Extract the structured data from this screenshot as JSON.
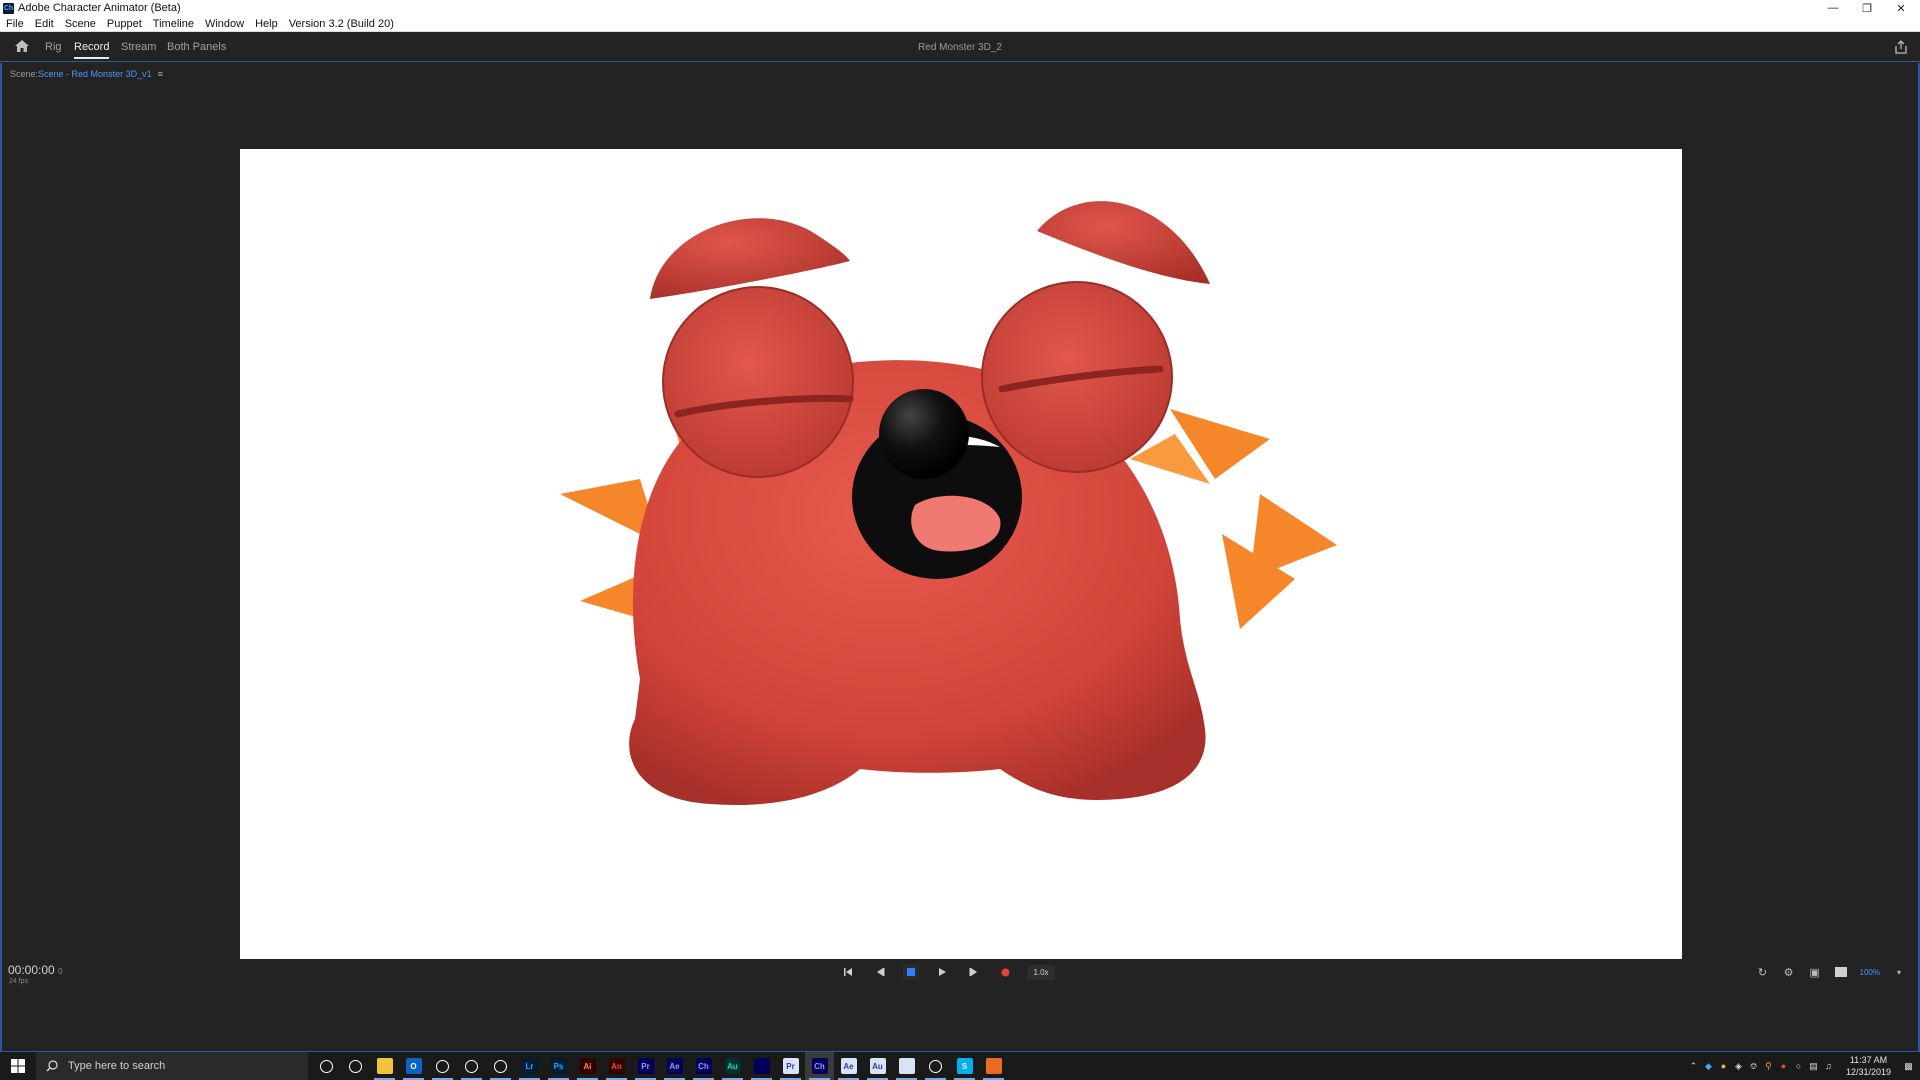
{
  "window": {
    "title": "Adobe Character Animator (Beta)",
    "app_icon": "Ch",
    "controls": [
      "minimize-icon",
      "restore-icon",
      "close-icon"
    ]
  },
  "menu": {
    "items": [
      "File",
      "Edit",
      "Scene",
      "Puppet",
      "Timeline",
      "Window",
      "Help",
      "Version 3.2 (Build 20)"
    ]
  },
  "workspace": {
    "tabs": [
      {
        "label": "Rig",
        "active": false
      },
      {
        "label": "Record",
        "active": true
      },
      {
        "label": "Stream",
        "active": false
      },
      {
        "label": "Both Panels",
        "active": false
      }
    ],
    "project_name": "Red Monster 3D_2"
  },
  "scene_panel": {
    "prefix": "Scene:",
    "scene_name": "Scene - Red Monster 3D_v1",
    "menu_glyph": "≡"
  },
  "footer": {
    "timecode": "00:00:00",
    "frame": "0",
    "fps": "24 fps",
    "speed": "1.0x",
    "zoom": "100%"
  },
  "colors": {
    "accent": "#2c58a0",
    "link": "#4f95ff",
    "record": "#e8413c",
    "monster_body": "#d94a3f",
    "spikes": "#f5862a",
    "background": "#232323"
  },
  "taskbar": {
    "search_placeholder": "Type here to search",
    "apps": [
      {
        "name": "cortana-icon",
        "label": "",
        "bg": "transparent",
        "fg": "#fff"
      },
      {
        "name": "task-view-icon",
        "label": "",
        "bg": "transparent",
        "fg": "#fff"
      },
      {
        "name": "file-explorer-icon",
        "label": "",
        "bg": "#f3c33b",
        "fg": "#000"
      },
      {
        "name": "outlook-icon",
        "label": "O",
        "bg": "#0a64c8",
        "fg": "#fff"
      },
      {
        "name": "chrome-icon",
        "label": "",
        "bg": "transparent",
        "fg": "#fff"
      },
      {
        "name": "chrome-badge-icon",
        "label": "",
        "bg": "transparent",
        "fg": "#fff"
      },
      {
        "name": "cinema4d-icon",
        "label": "",
        "bg": "transparent",
        "fg": "#fff"
      },
      {
        "name": "lightroom-icon",
        "label": "Lr",
        "bg": "#001d34",
        "fg": "#31a8ff"
      },
      {
        "name": "photoshop-icon",
        "label": "Ps",
        "bg": "#001d34",
        "fg": "#31a8ff"
      },
      {
        "name": "illustrator-icon",
        "label": "Ai",
        "bg": "#330000",
        "fg": "#ff9a00"
      },
      {
        "name": "animate-icon",
        "label": "An",
        "bg": "#330000",
        "fg": "#ff4a21"
      },
      {
        "name": "premiere-icon",
        "label": "Pr",
        "bg": "#00005b",
        "fg": "#9999ff"
      },
      {
        "name": "after-effects-icon",
        "label": "Ae",
        "bg": "#00005b",
        "fg": "#9999ff"
      },
      {
        "name": "character-animator-icon",
        "label": "Ch",
        "bg": "#00005b",
        "fg": "#9999ff"
      },
      {
        "name": "audition-icon",
        "label": "Au",
        "bg": "#00322b",
        "fg": "#00e4bb"
      },
      {
        "name": "media-encoder-icon",
        "label": "",
        "bg": "#00005b",
        "fg": "#9999ff"
      },
      {
        "name": "premiere-doc-icon",
        "label": "Pr",
        "bg": "#d7e4f5",
        "fg": "#2a3d8f"
      },
      {
        "name": "character-animator-active-icon",
        "label": "Ch",
        "bg": "#00005b",
        "fg": "#9999ff"
      },
      {
        "name": "after-effects-doc-icon",
        "label": "Ae",
        "bg": "#d7e4f5",
        "fg": "#2a3d8f"
      },
      {
        "name": "audition-doc-icon",
        "label": "Au",
        "bg": "#d7e4f5",
        "fg": "#2a3d8f"
      },
      {
        "name": "media-doc-icon",
        "label": "",
        "bg": "#d7e4f5",
        "fg": "#2a3d8f"
      },
      {
        "name": "cinema4d-2-icon",
        "label": "",
        "bg": "transparent",
        "fg": "#fff"
      },
      {
        "name": "skype-icon",
        "label": "S",
        "bg": "#00aff0",
        "fg": "#fff"
      },
      {
        "name": "misc-app-icon",
        "label": "",
        "bg": "#e86c1e",
        "fg": "#fff"
      }
    ],
    "clock_time": "11:37 AM",
    "clock_date": "12/31/2019"
  }
}
